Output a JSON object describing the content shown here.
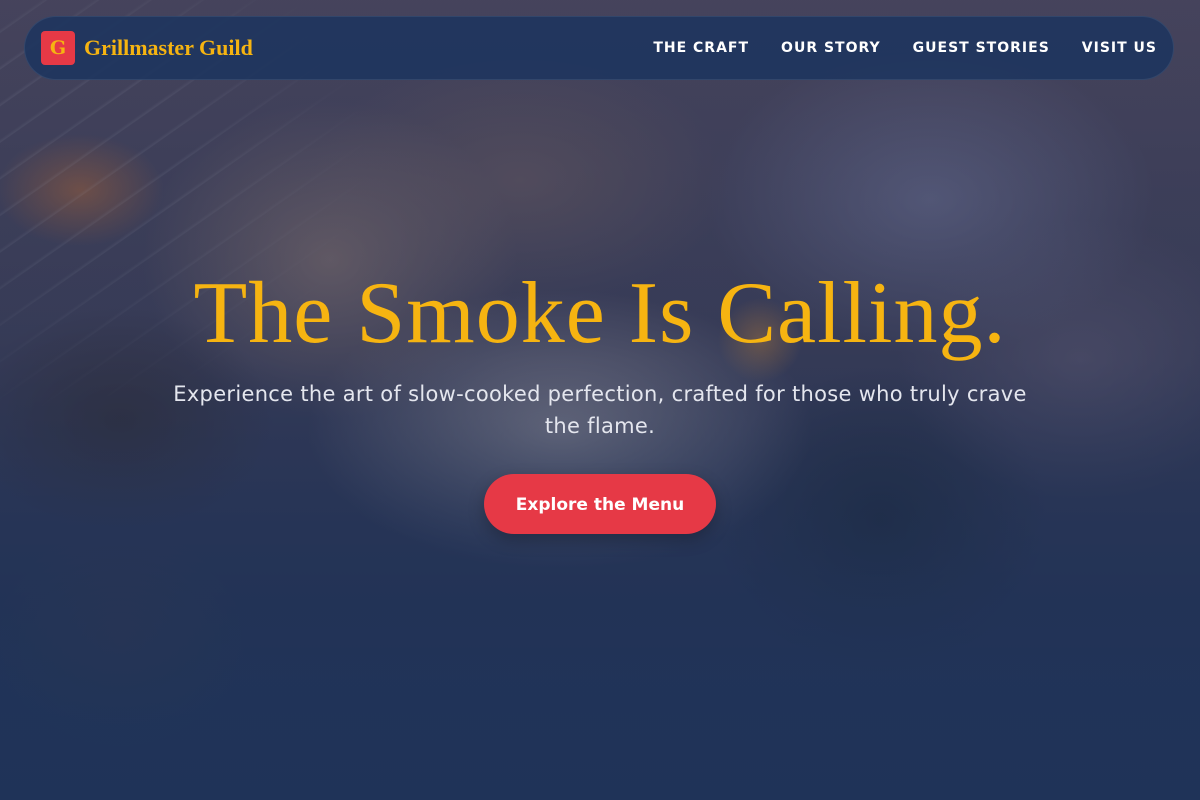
{
  "colors": {
    "accent_gold": "#f6b411",
    "accent_red": "#e63946",
    "navy": "#1f3358",
    "text_light": "#e4e6ee"
  },
  "header": {
    "logo_letter": "G",
    "brand_name": "Grillmaster Guild",
    "nav": [
      {
        "label": "THE CRAFT"
      },
      {
        "label": "OUR STORY"
      },
      {
        "label": "GUEST STORIES"
      },
      {
        "label": "VISIT US"
      }
    ]
  },
  "hero": {
    "background": "smoky-grill-photo",
    "title": "The Smoke Is Calling.",
    "subtitle": "Experience the art of slow-cooked perfection, crafted for those who truly crave the flame.",
    "cta_label": "Explore the Menu"
  }
}
